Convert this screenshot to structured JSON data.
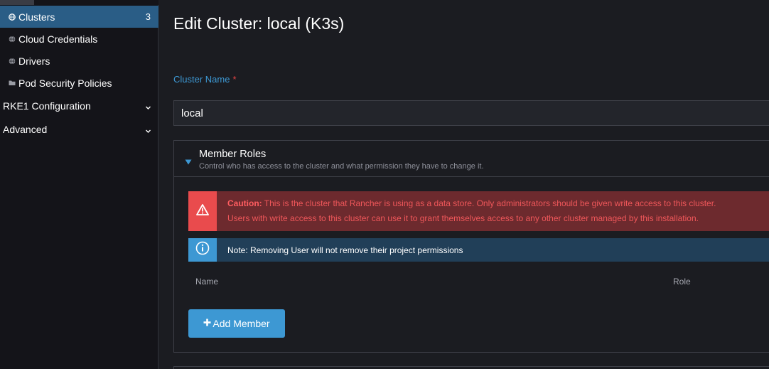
{
  "sidebar": {
    "items": [
      {
        "label": "Clusters",
        "count": "3",
        "icon": "globe-icon",
        "active": true
      },
      {
        "label": "Cloud Credentials",
        "icon": "globe-icon"
      },
      {
        "label": "Drivers",
        "icon": "globe-icon"
      },
      {
        "label": "Pod Security Policies",
        "icon": "folder-icon"
      }
    ],
    "groups": [
      {
        "label": "RKE1 Configuration",
        "icon": "chevron-down-icon"
      },
      {
        "label": "Advanced",
        "icon": "chevron-down-icon"
      }
    ]
  },
  "page": {
    "title": "Edit Cluster: local (K3s)"
  },
  "form": {
    "cluster_name_label": "Cluster Name",
    "required_mark": "*",
    "cluster_name_value": "local"
  },
  "member_roles": {
    "title": "Member Roles",
    "subtitle": "Control who has access to the cluster and what permission they have to change it.",
    "caution_bold": "Caution:",
    "caution_line1": " This is the cluster that Rancher is using as a data store. Only administrators should be given write access to this cluster.",
    "caution_line2": "Users with write access to this cluster can use it to grant themselves access to any other cluster managed by this installation.",
    "note": "Note: Removing User will not remove their project permissions",
    "columns": {
      "name": "Name",
      "role": "Role"
    },
    "add_button": "Add Member",
    "add_button_icon": "plus-icon"
  },
  "colors": {
    "accent": "#3d98d3",
    "active_nav": "#2a5d86",
    "danger": "#e94b4d",
    "danger_bg": "#6d2a2e",
    "info_bg": "#213f58"
  }
}
